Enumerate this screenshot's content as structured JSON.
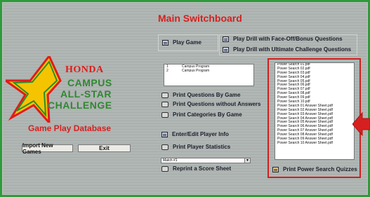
{
  "title": "Main Switchboard",
  "brand": {
    "honda": "HONDA",
    "campus": "CAMPUS",
    "allstar": "ALL-STAR",
    "challenge": "CHALLENGE",
    "subtitle": "Game Play Database"
  },
  "left_buttons": {
    "import": "Import New Games",
    "exit": "Exit"
  },
  "actions": {
    "play_game": "Play Game",
    "play_drill_faceoff": "Play Drill with Face-Off/Bonus Questions",
    "play_drill_ultimate": "Play Drill with Ultimate Challenge Questions",
    "print_by_game": "Print Questions By Game",
    "print_without_answers": "Print Questions without Answers",
    "print_categories": "Print Categories By Game",
    "edit_player": "Enter/Edit Player Info",
    "print_player_stats": "Print Player Statistics",
    "reprint_score": "Reprint a Score Sheet",
    "print_power_search": "Print Power Search Quizzes"
  },
  "games_list": [
    {
      "num": "1",
      "name": "Campus Program"
    },
    {
      "num": "2",
      "name": "Campus Program"
    }
  ],
  "match_combo": {
    "value": "Match #1",
    "arrow": "▼"
  },
  "power_search_items": [
    "Power Search 01.pdf",
    "Power Search 02.pdf",
    "Power Search 03.pdf",
    "Power Search 04.pdf",
    "Power Search 05.pdf",
    "Power Search 06.pdf",
    "Power Search 07.pdf",
    "Power Search 08.pdf",
    "Power Search 09.pdf",
    "Power Search 10.pdf",
    "Power Search 01 Answer Sheet.pdf",
    "Power Search 02 Answer Sheet.pdf",
    "Power Search 03 Answer Sheet.pdf",
    "Power Search 04 Answer Sheet.pdf",
    "Power Search 05 Answer Sheet.pdf",
    "Power Search 06 Answer Sheet.pdf",
    "Power Search 07 Answer Sheet.pdf",
    "Power Search 08 Answer Sheet.pdf",
    "Power Search 09 Answer Sheet.pdf",
    "Power Search 10 Answer Sheet.pdf"
  ],
  "colors": {
    "title_red": "#d62020",
    "brand_green": "#2b8c2b",
    "highlight_red": "#d21f1f",
    "outer_green": "#2f9a3c"
  }
}
